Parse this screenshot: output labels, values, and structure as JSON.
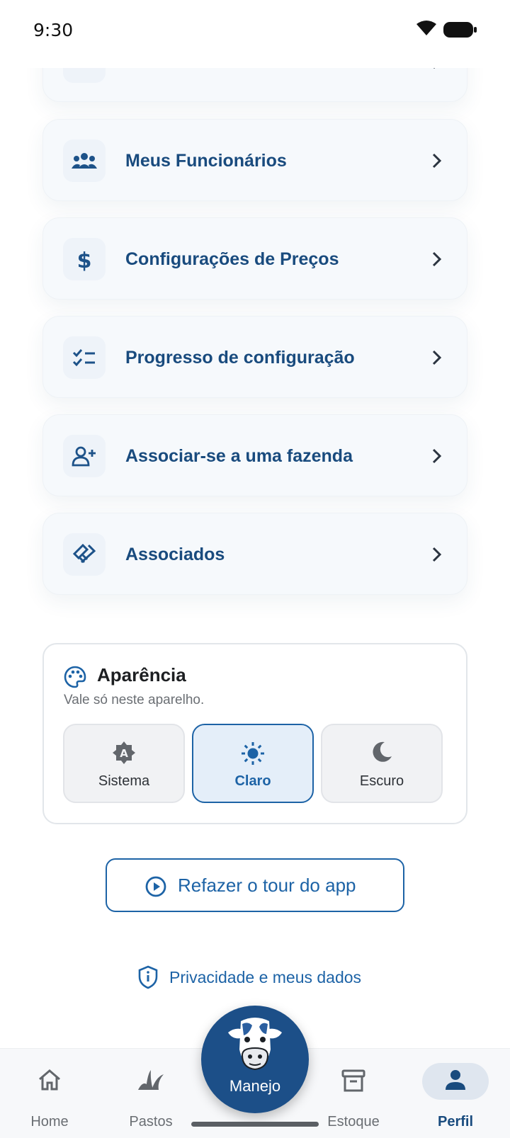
{
  "status_bar": {
    "time": "9:30"
  },
  "menu_items": [
    {
      "label": "",
      "icon": "document-icon"
    },
    {
      "label": "Meus Funcionários",
      "icon": "employees-icon"
    },
    {
      "label": "Configurações de Preços",
      "icon": "dollar-icon"
    },
    {
      "label": "Progresso de configuração",
      "icon": "checklist-icon"
    },
    {
      "label": "Associar-se a uma fazenda",
      "icon": "person-add-icon"
    },
    {
      "label": "Associados",
      "icon": "handshake-icon"
    }
  ],
  "appearance": {
    "title": "Aparência",
    "subtitle": "Vale só neste aparelho.",
    "options": [
      {
        "label": "Sistema",
        "icon": "auto-theme-icon",
        "selected": false
      },
      {
        "label": "Claro",
        "icon": "sun-icon",
        "selected": true
      },
      {
        "label": "Escuro",
        "icon": "moon-icon",
        "selected": false
      }
    ]
  },
  "tour_button": {
    "label": "Refazer o tour do app"
  },
  "privacy_link": {
    "label": "Privacidade e meus dados"
  },
  "bottom_nav": {
    "items": [
      {
        "label": "Home",
        "icon": "home-icon",
        "active": false
      },
      {
        "label": "Pastos",
        "icon": "grass-icon",
        "active": false
      },
      {
        "label": "Manejo",
        "icon": "cow-icon",
        "active": false
      },
      {
        "label": "Estoque",
        "icon": "archive-icon",
        "active": false
      },
      {
        "label": "Perfil",
        "icon": "person-icon",
        "active": true
      }
    ]
  },
  "colors": {
    "primary": "#1d63a6",
    "menu_label": "#194b7e",
    "fab": "#1c4f88",
    "card_bg": "#f6f9fc"
  }
}
